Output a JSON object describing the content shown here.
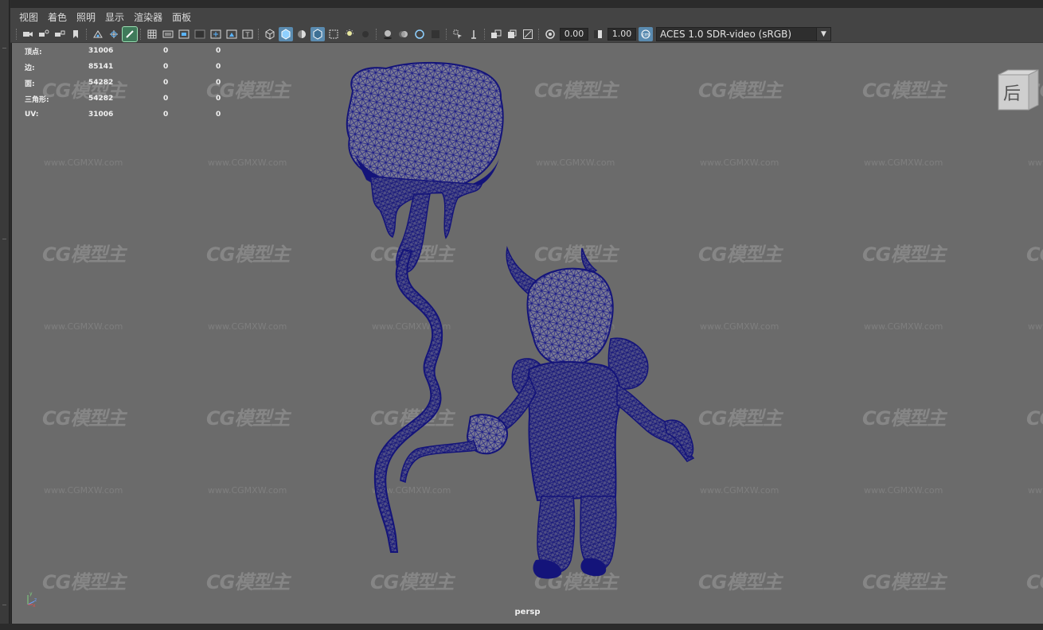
{
  "menu": {
    "items": [
      "视图",
      "着色",
      "照明",
      "显示",
      "渲染器",
      "面板"
    ]
  },
  "toolbar": {
    "gamma_value": "0.00",
    "exposure_value": "1.00",
    "color_management": "ACES 1.0 SDR-video (sRGB)",
    "icons": [
      "camera-icon",
      "camera-attributes-icon",
      "bookmark-icon",
      "image-plane-icon",
      "2d-pan-zoom-icon",
      "grease-pencil-icon",
      "grid-icon",
      "film-gate-icon",
      "resolution-gate-icon",
      "gate-mask-icon",
      "field-chart-icon",
      "safe-action-icon",
      "safe-title-icon",
      "wireframe-icon",
      "smooth-shade-icon",
      "default-material-icon",
      "wireframe-on-shaded-icon",
      "xray-icon",
      "use-all-lights-icon",
      "shadows-icon",
      "screen-space-ao-icon",
      "motion-blur-icon",
      "anti-aliasing-icon",
      "depth-of-field-icon",
      "isolate-select-icon",
      "xray-joints-icon",
      "xray-active-icon",
      "backface-icon",
      "exposure-icon",
      "gamma-icon",
      "color-management-icon"
    ]
  },
  "hud": {
    "rows": [
      {
        "label": "顶点:",
        "v1": "31006",
        "v2": "0",
        "v3": "0"
      },
      {
        "label": "边:",
        "v1": "85141",
        "v2": "0",
        "v3": "0"
      },
      {
        "label": "面:",
        "v1": "54282",
        "v2": "0",
        "v3": "0"
      },
      {
        "label": "三角形:",
        "v1": "54282",
        "v2": "0",
        "v3": "0"
      },
      {
        "label": "UV:",
        "v1": "31006",
        "v2": "0",
        "v3": "0"
      }
    ]
  },
  "viewcube": {
    "face_label": "后"
  },
  "camera_label": "persp",
  "watermark": {
    "logo": "CG模型主",
    "url": "www.CGMXW.com"
  },
  "colors": {
    "viewport_bg": "#6b6b6b",
    "wire": "#14147a",
    "accent": "#5a8bb0"
  }
}
